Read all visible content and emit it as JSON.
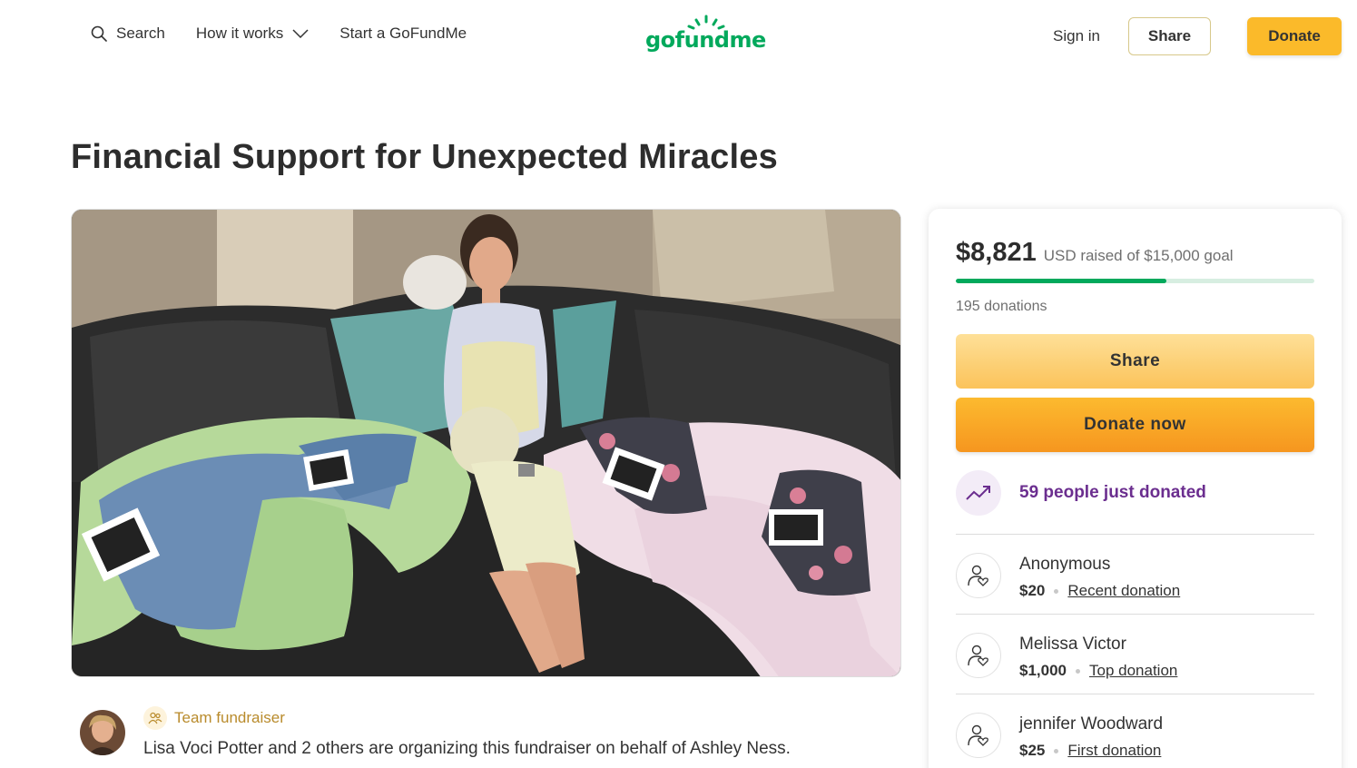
{
  "header": {
    "search_label": "Search",
    "how_it_works_label": "How it works",
    "start_label": "Start a GoFundMe",
    "logo_text": "gofundme",
    "signin_label": "Sign in",
    "share_label": "Share",
    "donate_label": "Donate"
  },
  "campaign": {
    "title": "Financial Support for Unexpected Miracles",
    "image_alt": "Expecting mother sitting on couch with twin baby outfits and ultrasound photos"
  },
  "organizer": {
    "team_label": "Team fundraiser",
    "description": "Lisa Voci Potter and 2 others are organizing this fundraiser on behalf of Ashley Ness."
  },
  "sidebar": {
    "raised_amount": "$8,821",
    "raised_text": "USD raised of $15,000 goal",
    "progress_fraction": 0.588,
    "donation_count": "195 donations",
    "share_label": "Share",
    "donate_now_label": "Donate now",
    "just_donated": "59 people just donated",
    "donors": [
      {
        "name": "Anonymous",
        "amount": "$20",
        "tag": "Recent donation"
      },
      {
        "name": "Melissa Victor",
        "amount": "$1,000",
        "tag": "Top donation"
      },
      {
        "name": "jennifer Woodward",
        "amount": "$25",
        "tag": "First donation"
      }
    ]
  },
  "colors": {
    "brand_green": "#02a95c",
    "donate_yellow": "#fbba2a",
    "accent_purple": "#6b2e8f"
  }
}
